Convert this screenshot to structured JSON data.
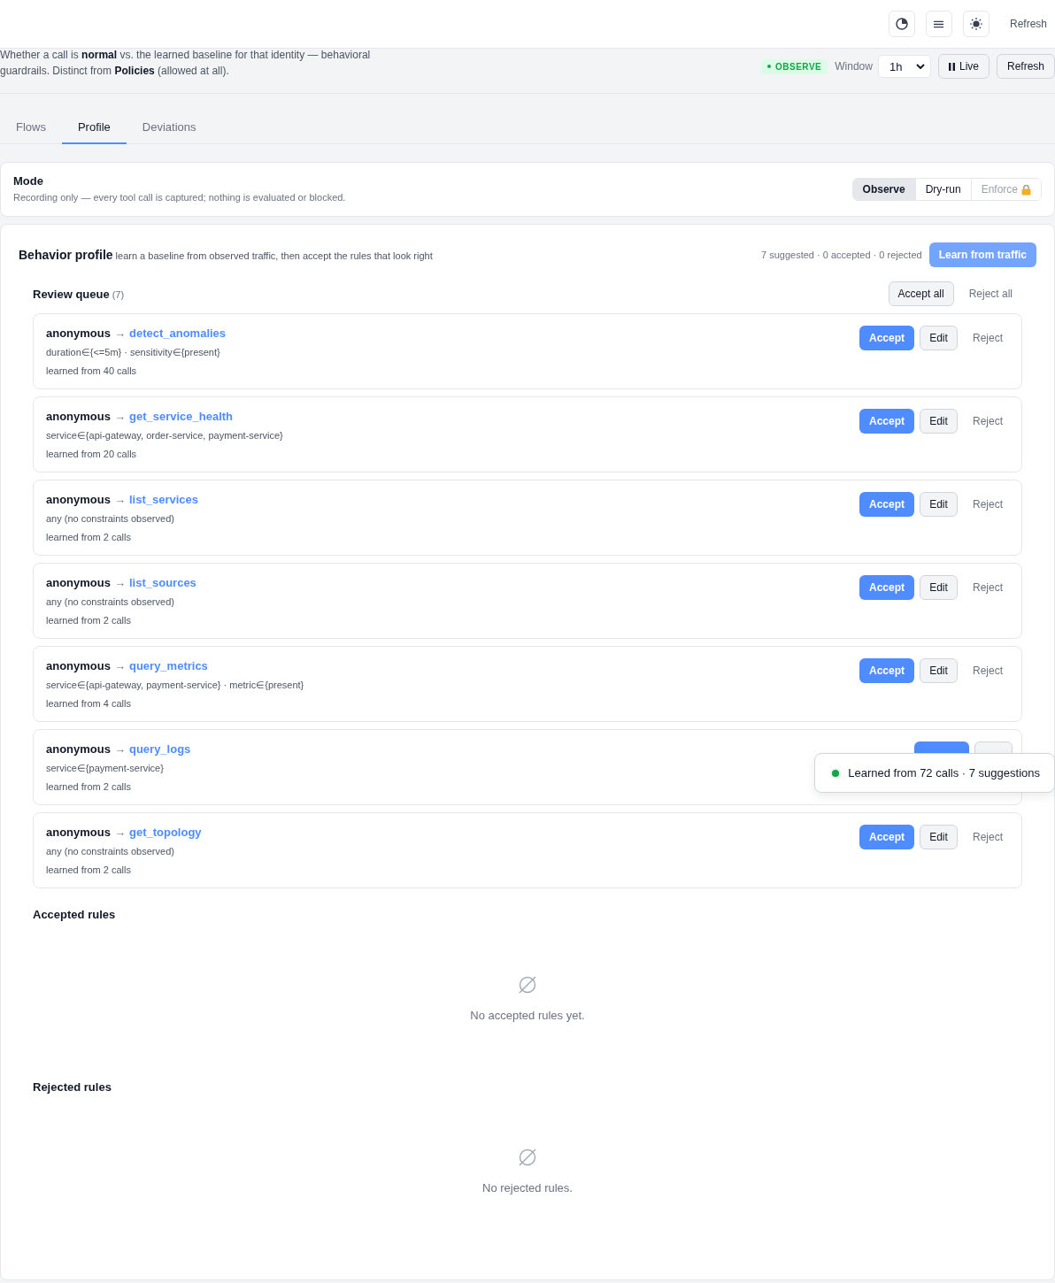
{
  "top_bar": {
    "refresh_button": "Refresh"
  },
  "header": {
    "description": "Whether a call is **normal** vs. the learned baseline for that identity — behavioral guardrails. Distinct from **Policies** (allowed at all).",
    "mode_badge": "OBSERVE",
    "window_label": "Window",
    "window_value": "1h",
    "live_button": "Live",
    "refresh_button": "Refresh"
  },
  "tabs": [
    {
      "label": "Flows",
      "selected": false
    },
    {
      "label": "Profile",
      "selected": true
    },
    {
      "label": "Deviations",
      "selected": false
    }
  ],
  "mode": {
    "title": "Mode",
    "description": "Recording only — every tool call is captured; nothing is evaluated or blocked.",
    "options": [
      {
        "label": "Observe",
        "selected": true,
        "locked": false
      },
      {
        "label": "Dry-run",
        "selected": false,
        "locked": false
      },
      {
        "label": "Enforce",
        "selected": false,
        "locked": true
      }
    ]
  },
  "behavior_profile": {
    "title": "Behavior profile",
    "subtitle": "learn a baseline from observed traffic, then accept the rules that look right",
    "summary": "7 suggested · 0 accepted · 0 rejected",
    "learn_button": "Learn from traffic",
    "review_queue": {
      "title": "Review queue",
      "count": "(7)",
      "accept_all": "Accept all",
      "reject_all": "Reject all",
      "rules": [
        {
          "identity": "anonymous",
          "arrow": "→",
          "tool": "detect_anomalies",
          "constraints": "duration∈{<=5m} · sensitivity∈{present}",
          "learned": "learned from 40 calls",
          "actions": [
            {
              "kind": "accept",
              "label": "Accept"
            },
            {
              "kind": "edit",
              "label": "Edit"
            },
            {
              "kind": "reject",
              "label": "Reject"
            }
          ]
        },
        {
          "identity": "anonymous",
          "arrow": "→",
          "tool": "get_service_health",
          "constraints": "service∈{api-gateway, order-service, payment-service}",
          "learned": "learned from 20 calls",
          "actions": [
            {
              "kind": "accept",
              "label": "Accept"
            },
            {
              "kind": "edit",
              "label": "Edit"
            },
            {
              "kind": "reject",
              "label": "Reject"
            }
          ]
        },
        {
          "identity": "anonymous",
          "arrow": "→",
          "tool": "list_services",
          "constraints": "any (no constraints observed)",
          "learned": "learned from 2 calls",
          "actions": [
            {
              "kind": "accept",
              "label": "Accept"
            },
            {
              "kind": "edit",
              "label": "Edit"
            },
            {
              "kind": "reject",
              "label": "Reject"
            }
          ]
        },
        {
          "identity": "anonymous",
          "arrow": "→",
          "tool": "list_sources",
          "constraints": "any (no constraints observed)",
          "learned": "learned from 2 calls",
          "actions": [
            {
              "kind": "accept",
              "label": "Accept"
            },
            {
              "kind": "edit",
              "label": "Edit"
            },
            {
              "kind": "reject",
              "label": "Reject"
            }
          ]
        },
        {
          "identity": "anonymous",
          "arrow": "→",
          "tool": "query_metrics",
          "constraints": "service∈{api-gateway, payment-service} · metric∈{present}",
          "learned": "learned from 4 calls",
          "actions": [
            {
              "kind": "accept",
              "label": "Accept"
            },
            {
              "kind": "edit",
              "label": "Edit"
            },
            {
              "kind": "reject",
              "label": "Reject"
            }
          ]
        },
        {
          "identity": "anonymous",
          "arrow": "→",
          "tool": "query_logs",
          "constraints": "service∈{payment-service}",
          "learned": "learned from 2 calls",
          "actions": [
            {
              "kind": "accept"
            },
            {
              "kind": "edit"
            }
          ]
        },
        {
          "identity": "anonymous",
          "arrow": "→",
          "tool": "get_topology",
          "constraints": "any (no constraints observed)",
          "learned": "learned from 2 calls",
          "actions": [
            {
              "kind": "accept",
              "label": "Accept"
            },
            {
              "kind": "edit",
              "label": "Edit"
            },
            {
              "kind": "reject",
              "label": "Reject"
            }
          ]
        }
      ]
    },
    "accepted_rules": {
      "title": "Accepted rules",
      "empty_text": "No accepted rules yet."
    },
    "rejected_rules": {
      "title": "Rejected rules",
      "empty_text": "No rejected rules."
    }
  },
  "toast": {
    "text": "Learned from 72 calls · 7 suggestions"
  }
}
